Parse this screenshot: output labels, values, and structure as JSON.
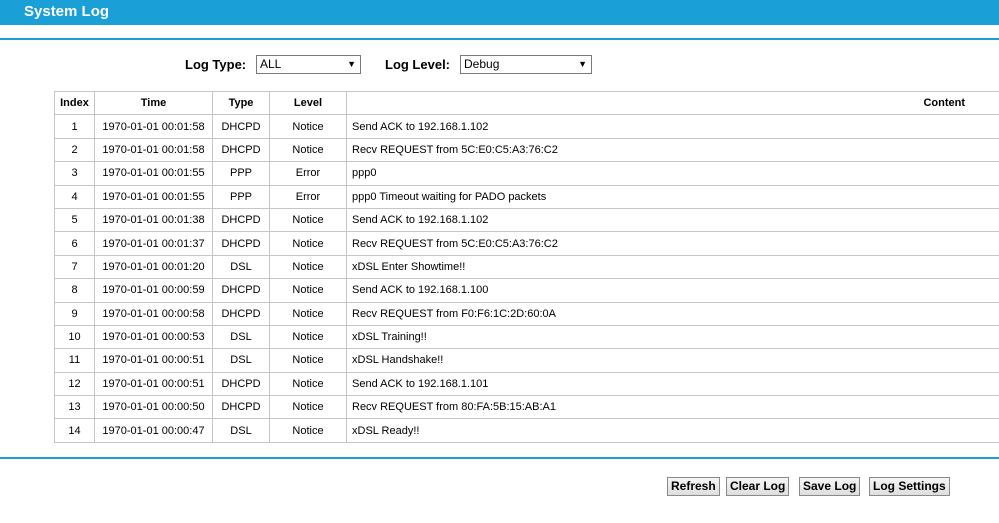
{
  "header": {
    "title": "System Log"
  },
  "filters": {
    "log_type_label": "Log Type:",
    "log_type_value": "ALL",
    "log_level_label": "Log Level:",
    "log_level_value": "Debug"
  },
  "table": {
    "columns": [
      "Index",
      "Time",
      "Type",
      "Level",
      "Content"
    ],
    "rows": [
      {
        "index": "1",
        "time": "1970-01-01 00:01:58",
        "type": "DHCPD",
        "level": "Notice",
        "content": "Send ACK to 192.168.1.102"
      },
      {
        "index": "2",
        "time": "1970-01-01 00:01:58",
        "type": "DHCPD",
        "level": "Notice",
        "content": "Recv REQUEST from 5C:E0:C5:A3:76:C2"
      },
      {
        "index": "3",
        "time": "1970-01-01 00:01:55",
        "type": "PPP",
        "level": "Error",
        "content": "ppp0"
      },
      {
        "index": "4",
        "time": "1970-01-01 00:01:55",
        "type": "PPP",
        "level": "Error",
        "content": "ppp0 Timeout waiting for PADO packets"
      },
      {
        "index": "5",
        "time": "1970-01-01 00:01:38",
        "type": "DHCPD",
        "level": "Notice",
        "content": "Send ACK to 192.168.1.102"
      },
      {
        "index": "6",
        "time": "1970-01-01 00:01:37",
        "type": "DHCPD",
        "level": "Notice",
        "content": "Recv REQUEST from 5C:E0:C5:A3:76:C2"
      },
      {
        "index": "7",
        "time": "1970-01-01 00:01:20",
        "type": "DSL",
        "level": "Notice",
        "content": "xDSL Enter Showtime!!"
      },
      {
        "index": "8",
        "time": "1970-01-01 00:00:59",
        "type": "DHCPD",
        "level": "Notice",
        "content": "Send ACK to 192.168.1.100"
      },
      {
        "index": "9",
        "time": "1970-01-01 00:00:58",
        "type": "DHCPD",
        "level": "Notice",
        "content": "Recv REQUEST from F0:F6:1C:2D:60:0A"
      },
      {
        "index": "10",
        "time": "1970-01-01 00:00:53",
        "type": "DSL",
        "level": "Notice",
        "content": "xDSL Training!!"
      },
      {
        "index": "11",
        "time": "1970-01-01 00:00:51",
        "type": "DSL",
        "level": "Notice",
        "content": "xDSL Handshake!!"
      },
      {
        "index": "12",
        "time": "1970-01-01 00:00:51",
        "type": "DHCPD",
        "level": "Notice",
        "content": "Send ACK to 192.168.1.101"
      },
      {
        "index": "13",
        "time": "1970-01-01 00:00:50",
        "type": "DHCPD",
        "level": "Notice",
        "content": "Recv REQUEST from 80:FA:5B:15:AB:A1"
      },
      {
        "index": "14",
        "time": "1970-01-01 00:00:47",
        "type": "DSL",
        "level": "Notice",
        "content": "xDSL Ready!!"
      }
    ]
  },
  "buttons": {
    "refresh": "Refresh",
    "clear_log": "Clear Log",
    "save_log": "Save Log",
    "log_settings": "Log Settings"
  },
  "colors": {
    "accent": "#1a9fd6",
    "border": "#c6c6c6"
  },
  "icons": {
    "dropdown": "chevron-down-icon"
  }
}
